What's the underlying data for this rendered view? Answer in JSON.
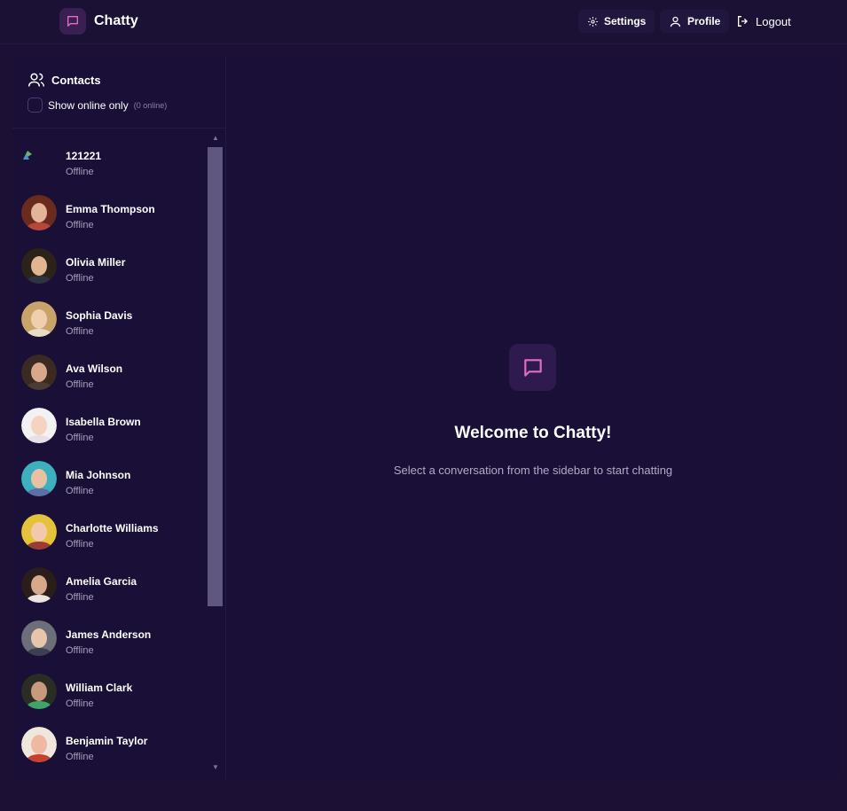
{
  "app": {
    "name": "Chatty"
  },
  "nav": {
    "settings_label": "Settings",
    "profile_label": "Profile",
    "logout_label": "Logout"
  },
  "sidebar": {
    "title": "Contacts",
    "filter_label": "Show online only",
    "online_count": "(0 online)",
    "contacts": [
      {
        "name": "121221",
        "status": "Offline",
        "avatar": "broken-image"
      },
      {
        "name": "Emma Thompson",
        "status": "Offline",
        "avatar": "photo"
      },
      {
        "name": "Olivia Miller",
        "status": "Offline",
        "avatar": "photo"
      },
      {
        "name": "Sophia Davis",
        "status": "Offline",
        "avatar": "photo"
      },
      {
        "name": "Ava Wilson",
        "status": "Offline",
        "avatar": "photo"
      },
      {
        "name": "Isabella Brown",
        "status": "Offline",
        "avatar": "photo"
      },
      {
        "name": "Mia Johnson",
        "status": "Offline",
        "avatar": "photo"
      },
      {
        "name": "Charlotte Williams",
        "status": "Offline",
        "avatar": "photo"
      },
      {
        "name": "Amelia Garcia",
        "status": "Offline",
        "avatar": "photo"
      },
      {
        "name": "James Anderson",
        "status": "Offline",
        "avatar": "photo"
      },
      {
        "name": "William Clark",
        "status": "Offline",
        "avatar": "photo"
      },
      {
        "name": "Benjamin Taylor",
        "status": "Offline",
        "avatar": "photo"
      }
    ]
  },
  "main": {
    "welcome_title": "Welcome to Chatty!",
    "welcome_subtitle": "Select a conversation from the sidebar to start chatting"
  },
  "colors": {
    "background": "#1c1035",
    "panel": "#190f37",
    "accent": "#e26dc7",
    "muted_text": "#a79fbd"
  }
}
